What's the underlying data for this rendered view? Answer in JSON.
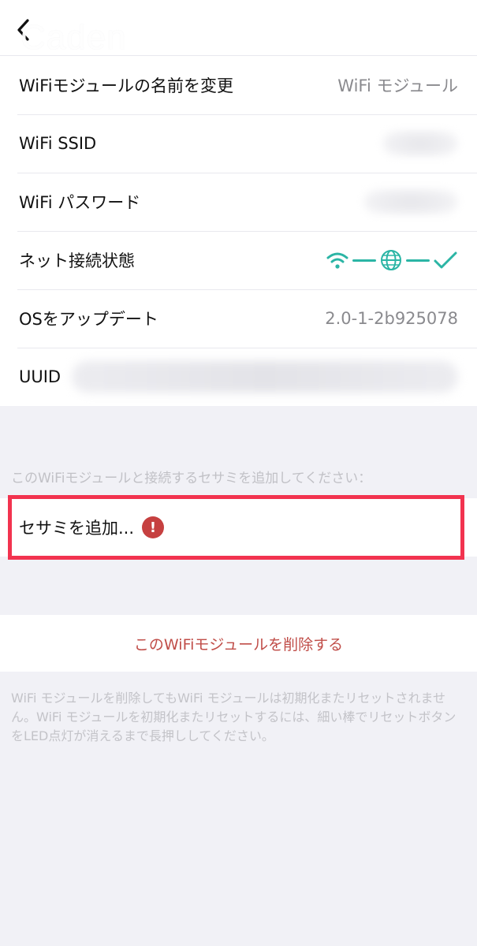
{
  "nav": {
    "title": "Caden",
    "back_icon": "chevron-left-icon"
  },
  "settings": {
    "rows": [
      {
        "label": "WiFiモジュールの名前を変更",
        "value": "WiFi モジュール"
      },
      {
        "label": "WiFi SSID"
      },
      {
        "label": "WiFi パスワード"
      },
      {
        "label": "ネット接続状態",
        "icons": [
          "wifi-icon",
          "globe-icon",
          "checkmark-icon"
        ]
      },
      {
        "label": "OSをアップデート",
        "value": "2.0-1-2b925078"
      },
      {
        "label": "UUID"
      }
    ]
  },
  "sesame_section": {
    "header": "このWiFiモジュールと接続するセサミを追加してください：",
    "add_label": "セサミを追加...",
    "alert_icon": "!"
  },
  "delete": {
    "label": "このWiFiモジュールを削除する"
  },
  "footer": {
    "note": "WiFi モジュールを削除してもWiFi モジュールは初期化またリセットされません。WiFi モジュールを初期化またリセットするには、細い棒でリセットボタンをLED点灯が消えるまで長押ししてください。"
  },
  "colors": {
    "accent_teal": "#2bb5a5",
    "alert_red": "#c64040",
    "delete_red": "#c04d48",
    "highlight_red": "#f2334f",
    "background": "#f1f1f6"
  }
}
